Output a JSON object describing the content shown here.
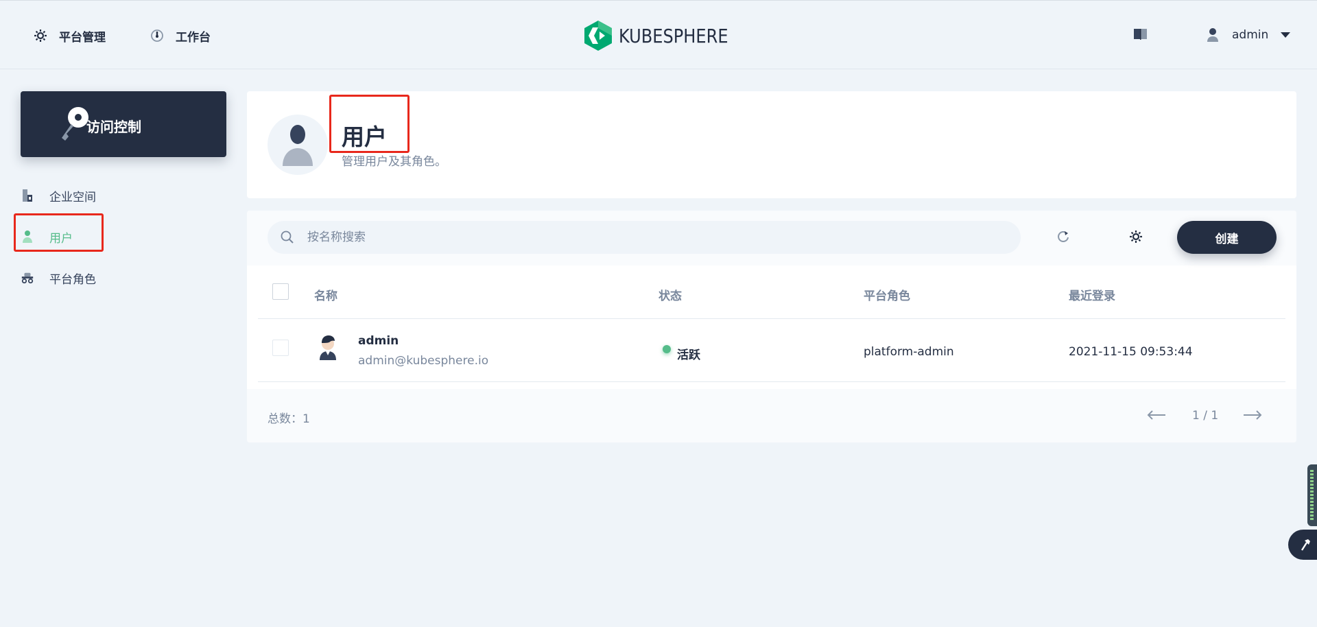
{
  "header": {
    "nav": {
      "platform_label": "平台管理",
      "workbench_label": "工作台"
    },
    "logo_text": "KUBESPHERE",
    "user": {
      "name": "admin"
    }
  },
  "sidebar": {
    "title": "访问控制",
    "items": [
      {
        "label": "企业空间",
        "icon": "workspace-icon",
        "active": false
      },
      {
        "label": "用户",
        "icon": "user-icon",
        "active": true
      },
      {
        "label": "平台角色",
        "icon": "roles-icon",
        "active": false
      }
    ]
  },
  "banner": {
    "title": "用户",
    "description": "管理用户及其角色。"
  },
  "toolbar": {
    "search_placeholder": "按名称搜索",
    "create_label": "创建"
  },
  "table": {
    "columns": [
      "名称",
      "状态",
      "平台角色",
      "最近登录"
    ],
    "rows": [
      {
        "name": "admin",
        "email": "admin@kubesphere.io",
        "status": "活跃",
        "role": "platform-admin",
        "last_login": "2021-11-15 09:53:44"
      }
    ]
  },
  "footer": {
    "total_label": "总数：1",
    "page_text": "1 / 1"
  },
  "colors": {
    "brand_dark": "#242e42",
    "accent_green": "#55bc8a",
    "highlight_red": "#e8281c",
    "background": "#eff4f9"
  }
}
